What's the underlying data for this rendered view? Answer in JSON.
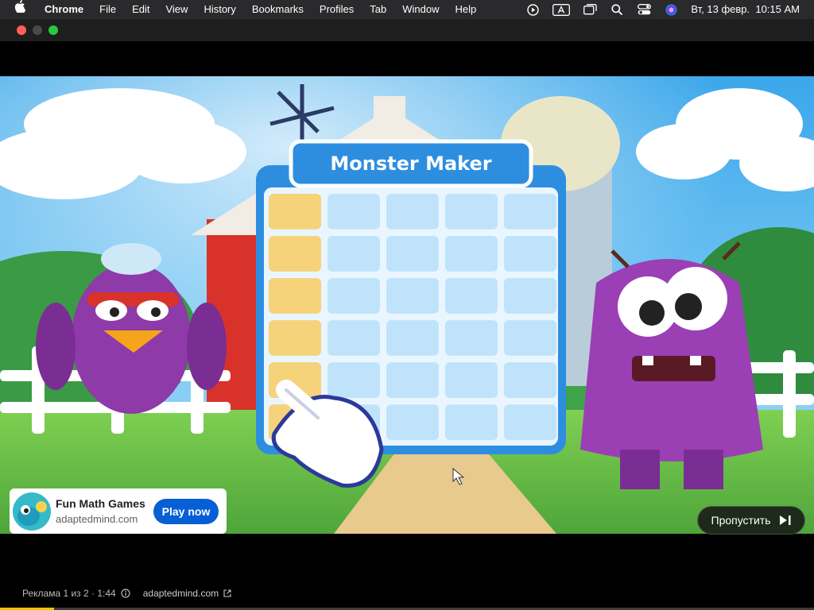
{
  "menubar": {
    "app": "Chrome",
    "items": [
      "File",
      "Edit",
      "View",
      "History",
      "Bookmarks",
      "Profiles",
      "Tab",
      "Window",
      "Help"
    ],
    "clock": "Вт, 13 февр.  10:15 AM",
    "icons": [
      "play-circle-icon",
      "keyboard-a-icon",
      "screen-mirror-icon",
      "search-icon",
      "control-center-icon",
      "siri-icon"
    ]
  },
  "window": {
    "traffic_lights": {
      "close": "#ff5f57",
      "minimize": "#4a4a4a",
      "maximize": "#28c840"
    }
  },
  "video": {
    "game_title": "Monster Maker",
    "colors": {
      "sky": "#5ab8ef",
      "grass": "#6cc24a",
      "monster_purple": "#9b3fb5",
      "board": "#2d8ee0",
      "tile": "#bfe3fb",
      "tile_selected": "#f6d27a"
    }
  },
  "ad": {
    "title": "Fun Math Games",
    "domain": "adaptedmind.com",
    "cta": "Play now",
    "cta_color": "#065fd4"
  },
  "skip": {
    "label": "Пропустить"
  },
  "ad_info": {
    "counter": "Реклама 1 из 2 · 1:44",
    "link": "adaptedmind.com"
  },
  "progress": {
    "fraction": 0.066
  }
}
